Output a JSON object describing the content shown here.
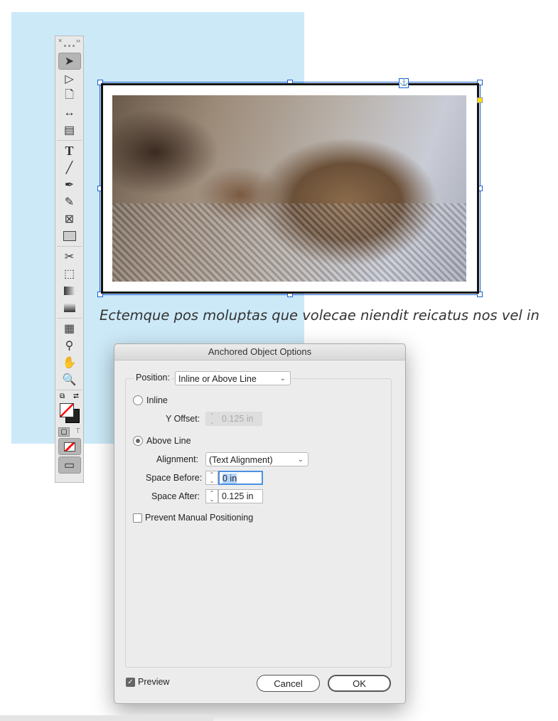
{
  "caption": "Ectemque pos moluptas que volecae niendit reicatus nos vel in",
  "toolbar": {
    "close": "×",
    "collapse": "››",
    "tools": [
      "selection",
      "direct-selection",
      "page",
      "gap",
      "content-collector",
      "type",
      "line",
      "pen",
      "pencil",
      "rectangle-frame",
      "rectangle",
      "scissors",
      "free-transform",
      "gradient-swatch",
      "gradient-feather",
      "note",
      "eyedropper",
      "hand",
      "zoom"
    ]
  },
  "dialog": {
    "title": "Anchored Object Options",
    "position_label": "Position:",
    "position_value": "Inline or Above Line",
    "inline_label": "Inline",
    "y_offset_label": "Y Offset:",
    "y_offset_value": "0.125 in",
    "above_line_label": "Above Line",
    "alignment_label": "Alignment:",
    "alignment_value": "(Text Alignment)",
    "space_before_label": "Space Before:",
    "space_before_value": "0 in",
    "space_after_label": "Space After:",
    "space_after_value": "0.125 in",
    "prevent_label": "Prevent Manual Positioning",
    "preview_label": "Preview",
    "cancel": "Cancel",
    "ok": "OK"
  }
}
